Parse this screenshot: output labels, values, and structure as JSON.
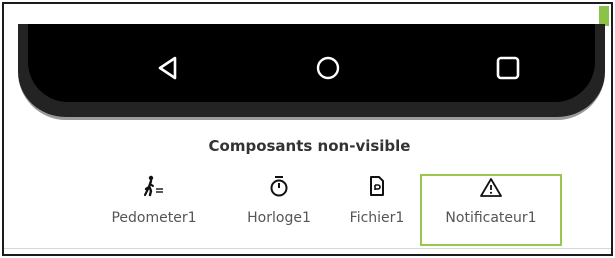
{
  "navbar": {
    "buttons": [
      {
        "name": "back",
        "icon": "triangle-back-icon"
      },
      {
        "name": "home",
        "icon": "circle-home-icon"
      },
      {
        "name": "recent",
        "icon": "square-recents-icon"
      }
    ]
  },
  "nonvisible": {
    "title": "Composants non-visible",
    "items": [
      {
        "label": "Pedometer1",
        "icon": "walking-person-icon"
      },
      {
        "label": "Horloge1",
        "icon": "stopwatch-icon"
      },
      {
        "label": "Fichier1",
        "icon": "file-icon"
      },
      {
        "label": "Notificateur1",
        "icon": "warning-icon",
        "selected": true
      }
    ]
  },
  "colors": {
    "selection_border": "#9bc74e",
    "phone_body": "#000000",
    "accent_corner": "#8bc34a"
  }
}
